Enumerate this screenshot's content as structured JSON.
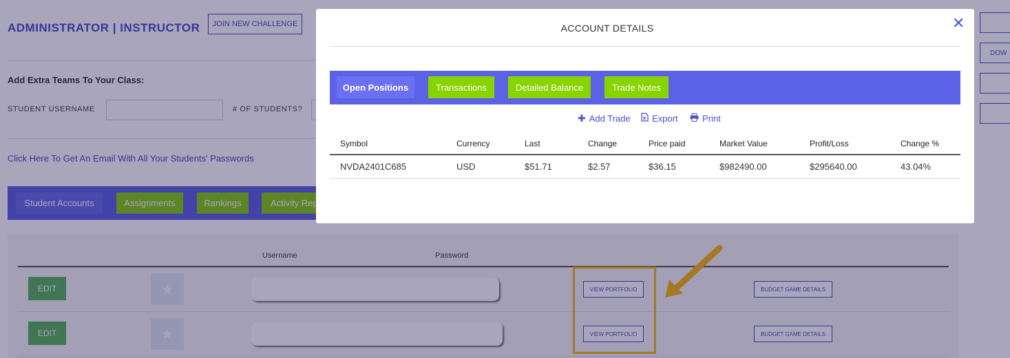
{
  "page": {
    "title": "ADMINISTRATOR | INSTRUCTOR",
    "join_button": "JOIN NEW CHALLENGE",
    "extra_teams_heading": "Add Extra Teams To Your Class:",
    "student_username_label": "STUDENT USERNAME",
    "num_students_label": "# OF STUDENTS?",
    "email_link": "Click Here To Get An Email With All Your Students' Passwords",
    "right_button_partial": "DOW",
    "tabs": [
      "Student Accounts",
      "Assignments",
      "Rankings",
      "Activity Rep"
    ],
    "table_headers": {
      "username": "Username",
      "password": "Password"
    },
    "rows": [
      {
        "edit": "EDIT",
        "view_portfolio": "VIEW PORTFOLIO",
        "budget": "BUDGET GAME DETAILS"
      },
      {
        "edit": "EDIT",
        "view_portfolio": "VIEW PORTFOLIO",
        "budget": "BUDGET GAME DETAILS"
      }
    ]
  },
  "modal": {
    "title": "ACCOUNT DETAILS",
    "close_symbol": "✕",
    "tabs": [
      "Open Positions",
      "Transactions",
      "Detailed Balance",
      "Trade Notes"
    ],
    "actions": [
      {
        "icon": "plus-icon",
        "label": "Add Trade"
      },
      {
        "icon": "export-icon",
        "label": "Export"
      },
      {
        "icon": "print-icon",
        "label": "Print"
      }
    ],
    "columns": [
      "Symbol",
      "Currency",
      "Last",
      "Change",
      "Price paid",
      "Market Value",
      "Profit/Loss",
      "Change %"
    ],
    "positions": [
      [
        "NVDA2401C685",
        "USD",
        "$51.71",
        "$2.57",
        "$36.15",
        "$982490.00",
        "$295640.00",
        "43.04%"
      ]
    ]
  },
  "colors": {
    "accent": "#3a3fc4",
    "tabbar": "#5c62e8",
    "green_tab": "#88d400",
    "edit_green": "#4caf50",
    "highlight": "#f5b400"
  }
}
